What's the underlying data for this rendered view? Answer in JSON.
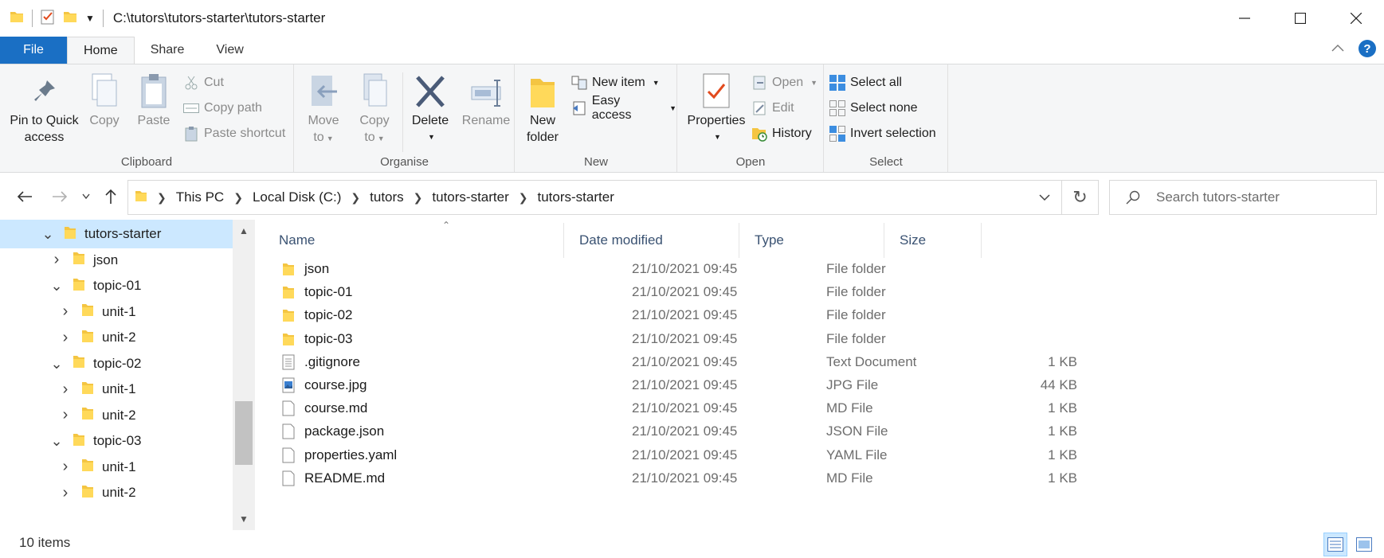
{
  "window": {
    "title": "C:\\tutors\\tutors-starter\\tutors-starter"
  },
  "ribbon_tabs": [
    "File",
    "Home",
    "Share",
    "View"
  ],
  "clipboard": {
    "label": "Clipboard",
    "pin": "Pin to Quick access",
    "pin_line1": "Pin to Quick",
    "pin_line2": "access",
    "copy": "Copy",
    "paste": "Paste",
    "cut": "Cut",
    "copy_path": "Copy path",
    "paste_shortcut": "Paste shortcut"
  },
  "organise": {
    "label": "Organise",
    "move_to_1": "Move",
    "move_to_2": "to",
    "copy_to_1": "Copy",
    "copy_to_2": "to",
    "delete": "Delete",
    "rename": "Rename"
  },
  "new_group": {
    "label": "New",
    "new_folder_1": "New",
    "new_folder_2": "folder",
    "new_item": "New item",
    "easy_access": "Easy access"
  },
  "open_group": {
    "label": "Open",
    "properties": "Properties",
    "open": "Open",
    "edit": "Edit",
    "history": "History"
  },
  "select_group": {
    "label": "Select",
    "select_all": "Select all",
    "select_none": "Select none",
    "invert": "Invert selection"
  },
  "breadcrumb": [
    "This PC",
    "Local Disk (C:)",
    "tutors",
    "tutors-starter",
    "tutors-starter"
  ],
  "search": {
    "placeholder": "Search tutors-starter"
  },
  "tree": [
    {
      "label": "tutors-starter",
      "level": 0,
      "expanded": true,
      "selected": true
    },
    {
      "label": "json",
      "level": 1,
      "expanded": false
    },
    {
      "label": "topic-01",
      "level": 1,
      "expanded": true
    },
    {
      "label": "unit-1",
      "level": 2,
      "expanded": false
    },
    {
      "label": "unit-2",
      "level": 2,
      "expanded": false
    },
    {
      "label": "topic-02",
      "level": 1,
      "expanded": true
    },
    {
      "label": "unit-1",
      "level": 2,
      "expanded": false
    },
    {
      "label": "unit-2",
      "level": 2,
      "expanded": false
    },
    {
      "label": "topic-03",
      "level": 1,
      "expanded": true
    },
    {
      "label": "unit-1",
      "level": 2,
      "expanded": false
    },
    {
      "label": "unit-2",
      "level": 2,
      "expanded": false
    }
  ],
  "columns": {
    "name": "Name",
    "date": "Date modified",
    "type": "Type",
    "size": "Size"
  },
  "files": [
    {
      "name": "json",
      "date": "21/10/2021 09:45",
      "type": "File folder",
      "size": "",
      "icon": "folder-icon"
    },
    {
      "name": "topic-01",
      "date": "21/10/2021 09:45",
      "type": "File folder",
      "size": "",
      "icon": "folder-icon"
    },
    {
      "name": "topic-02",
      "date": "21/10/2021 09:45",
      "type": "File folder",
      "size": "",
      "icon": "folder-icon"
    },
    {
      "name": "topic-03",
      "date": "21/10/2021 09:45",
      "type": "File folder",
      "size": "",
      "icon": "folder-icon"
    },
    {
      "name": ".gitignore",
      "date": "21/10/2021 09:45",
      "type": "Text Document",
      "size": "1 KB",
      "icon": "text-file-icon"
    },
    {
      "name": "course.jpg",
      "date": "21/10/2021 09:45",
      "type": "JPG File",
      "size": "44 KB",
      "icon": "image-file-icon"
    },
    {
      "name": "course.md",
      "date": "21/10/2021 09:45",
      "type": "MD File",
      "size": "1 KB",
      "icon": "file-icon"
    },
    {
      "name": "package.json",
      "date": "21/10/2021 09:45",
      "type": "JSON File",
      "size": "1 KB",
      "icon": "file-icon"
    },
    {
      "name": "properties.yaml",
      "date": "21/10/2021 09:45",
      "type": "YAML File",
      "size": "1 KB",
      "icon": "file-icon"
    },
    {
      "name": "README.md",
      "date": "21/10/2021 09:45",
      "type": "MD File",
      "size": "1 KB",
      "icon": "file-icon"
    }
  ],
  "status": {
    "items": "10 items"
  },
  "colors": {
    "accent": "#1a6fc4",
    "selection": "#cce8ff",
    "folder": "#f4c542"
  }
}
